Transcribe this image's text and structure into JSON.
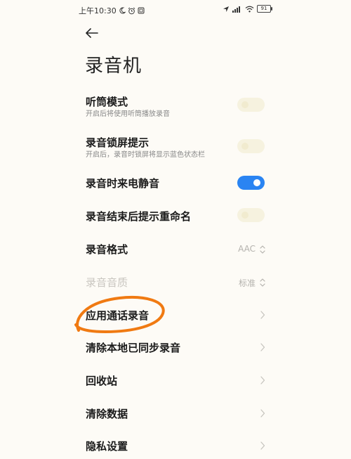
{
  "status": {
    "time": "上午10:30",
    "battery": "91"
  },
  "page": {
    "title": "录音机"
  },
  "settings": [
    {
      "label": "听筒模式",
      "desc": "开启后将使用听筒播放录音",
      "control": "toggle",
      "state": "off"
    },
    {
      "label": "录音锁屏提示",
      "desc": "开启后，录音时锁屏将显示蓝色状态栏",
      "control": "toggle",
      "state": "off"
    },
    {
      "label": "录音时来电静音",
      "control": "toggle",
      "state": "on"
    },
    {
      "label": "录音结束后提示重命名",
      "control": "toggle",
      "state": "off"
    },
    {
      "label": "录音格式",
      "control": "select",
      "value": "AAC"
    },
    {
      "label": "录音音质",
      "control": "select",
      "value": "标准",
      "disabled": true
    },
    {
      "label": "应用通话录音",
      "control": "link"
    },
    {
      "label": "清除本地已同步录音",
      "control": "link"
    },
    {
      "label": "回收站",
      "control": "link"
    },
    {
      "label": "清除数据",
      "control": "link"
    },
    {
      "label": "隐私设置",
      "control": "link"
    }
  ],
  "colors": {
    "accent": "#2a84f2",
    "annotation": "#f07a12",
    "background": "#fdfbf6"
  }
}
